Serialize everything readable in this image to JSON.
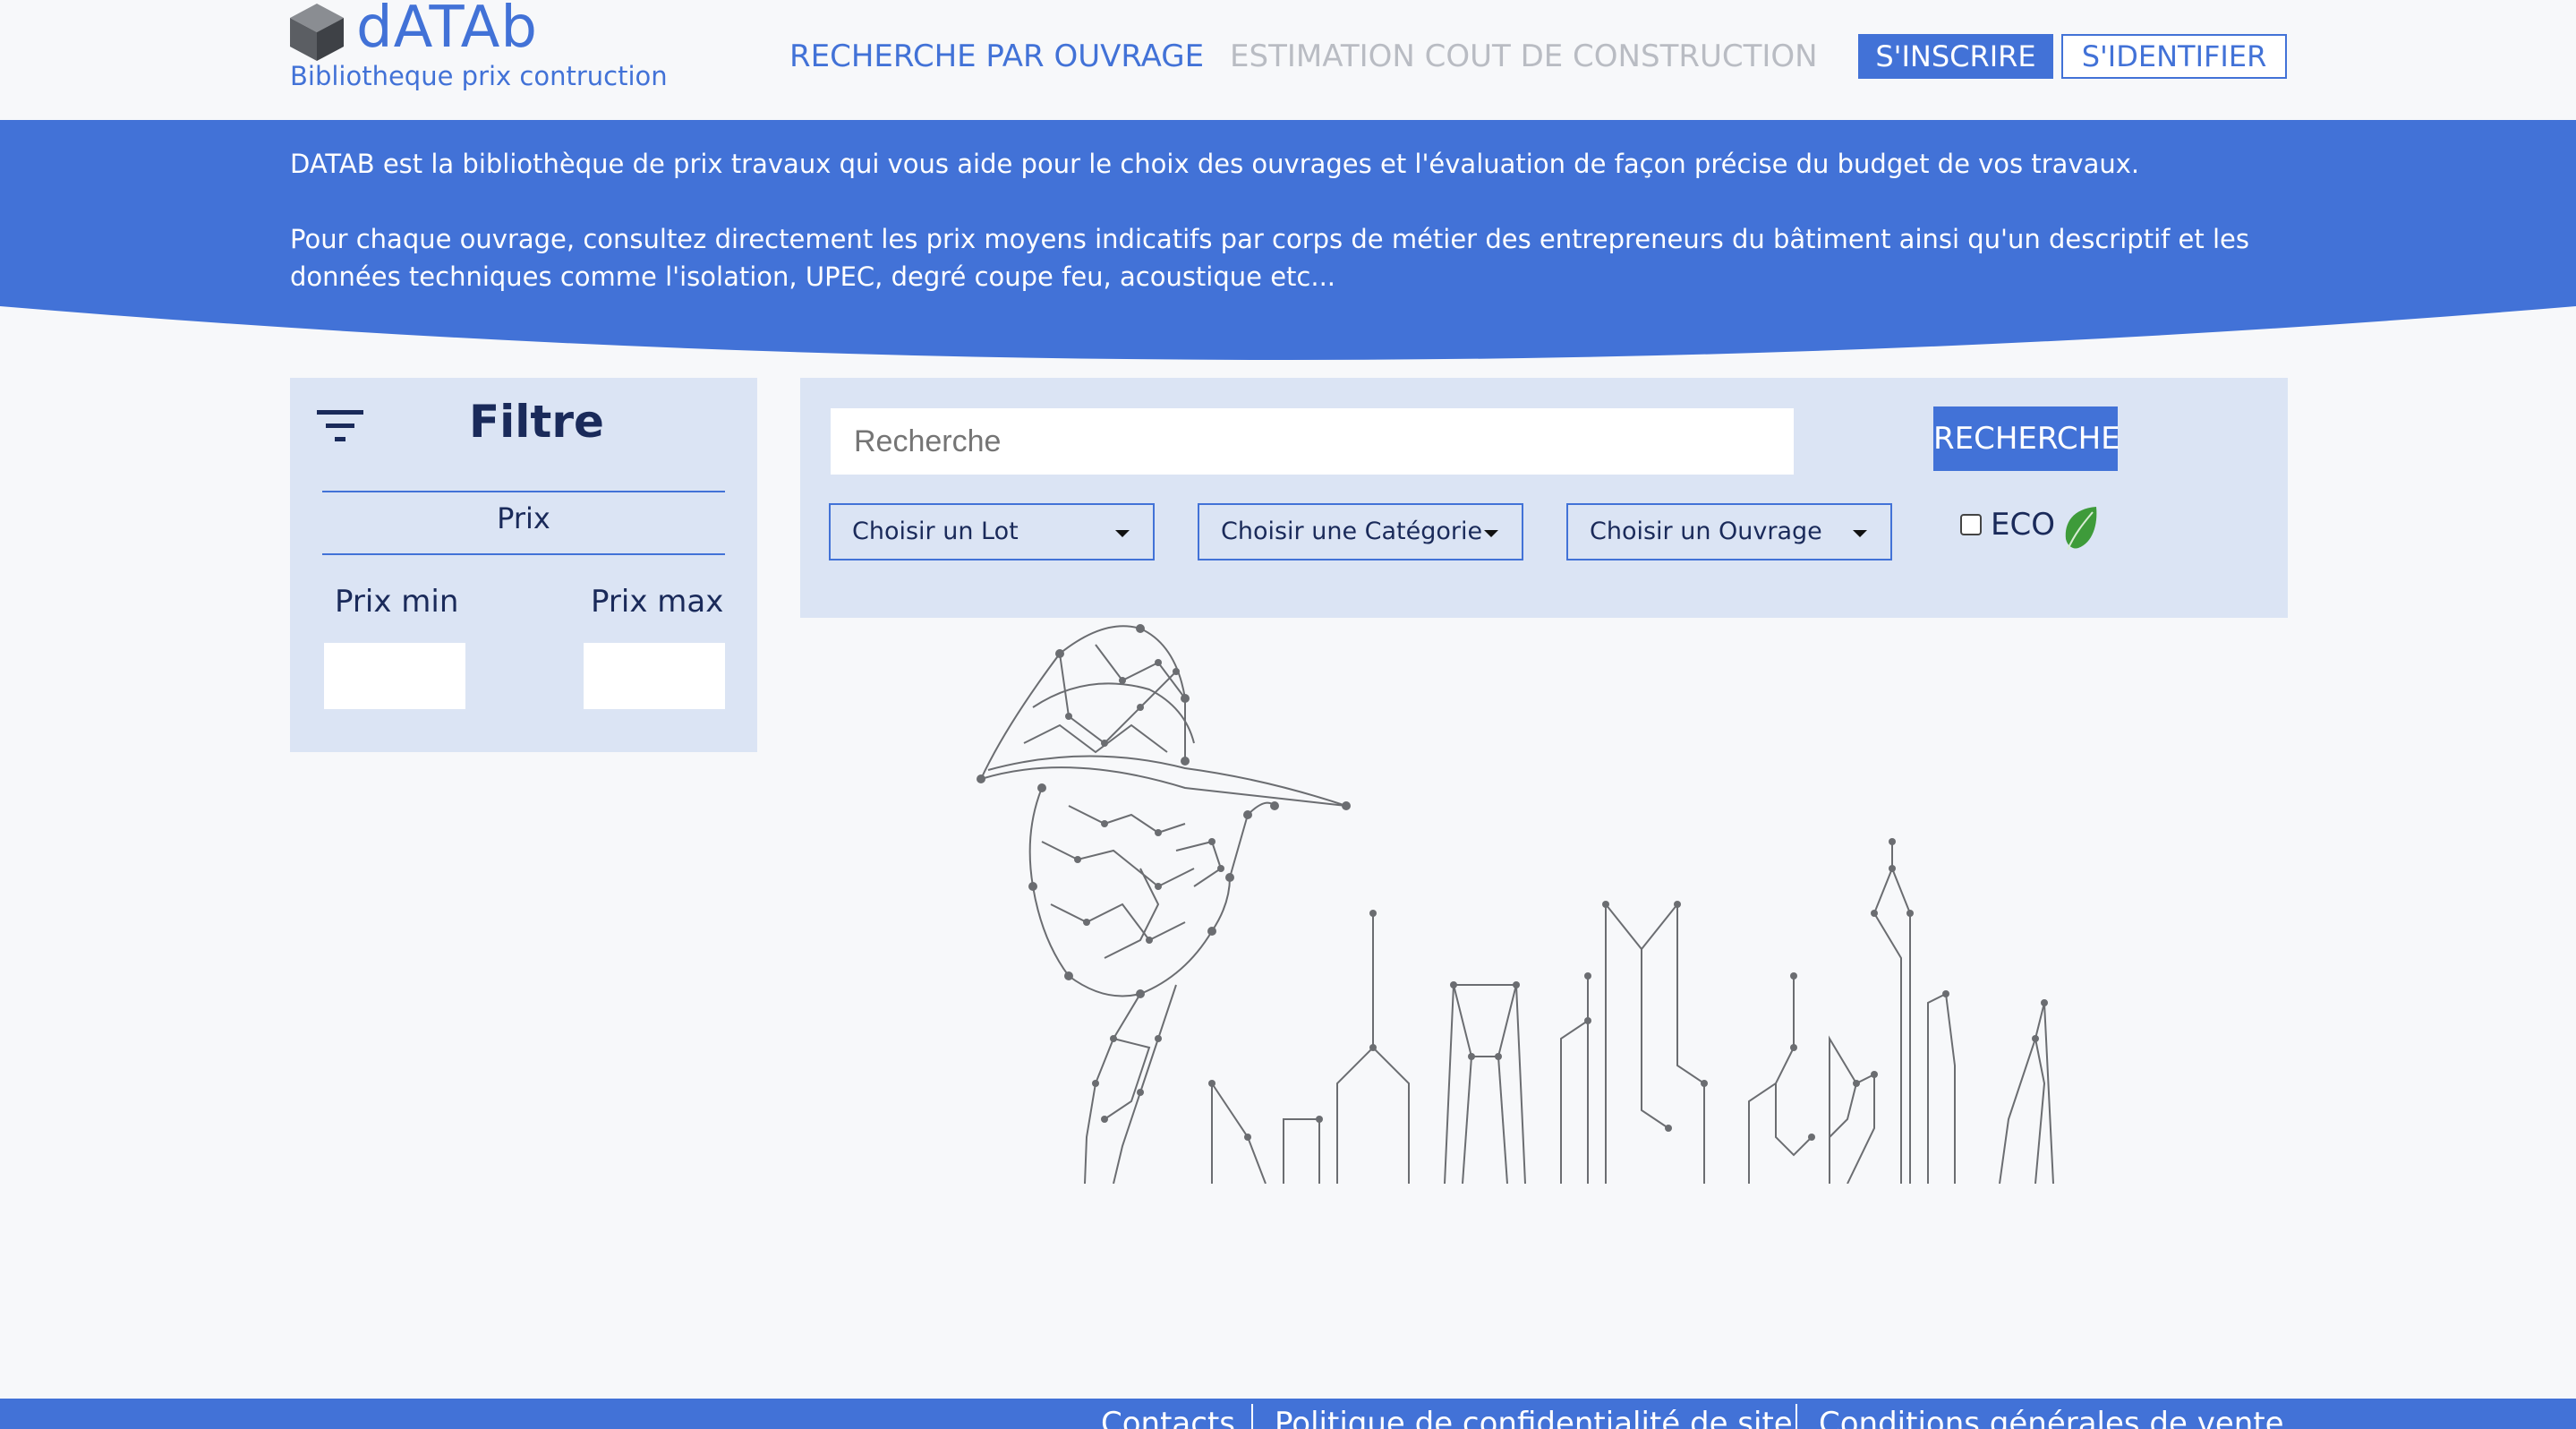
{
  "header": {
    "logo_name": "dATAb",
    "logo_tagline": "Bibliotheque prix contruction",
    "nav": [
      {
        "label": "RECHERCHE PAR OUVRAGE",
        "state": "active"
      },
      {
        "label": "ESTIMATION COUT DE CONSTRUCTION",
        "state": "inactive"
      }
    ],
    "signup_label": "S'INSCRIRE",
    "login_label": "S'IDENTIFIER"
  },
  "banner": {
    "paragraph1": "DATAB est la bibliothèque de prix travaux qui vous aide pour le choix des ouvrages et l'évaluation de façon précise du budget de vos travaux.",
    "paragraph2_line1": "Pour chaque ouvrage, consultez directement les prix moyens indicatifs par corps de métier des entrepreneurs du bâtiment ainsi qu'un descriptif et les",
    "paragraph2_line2": "données techniques comme l'isolation, UPEC, degré coupe feu, acoustique etc..."
  },
  "filter": {
    "title": "Filtre",
    "section": "Prix",
    "min_label": "Prix min",
    "max_label": "Prix max",
    "min_value": "",
    "max_value": ""
  },
  "search": {
    "placeholder": "Recherche",
    "button_label": "RECHERCHE",
    "dropdowns": [
      "Choisir un Lot",
      "Choisir une Catégorie",
      "Choisir un Ouvrage"
    ],
    "eco_label": "ECO",
    "eco_checked": false
  },
  "footer": {
    "links": [
      "Contacts",
      "Politique de confidentialité de site",
      "Conditions générales de vente"
    ]
  },
  "colors": {
    "primary": "#4272d7",
    "panel_bg": "#dbe4f4",
    "page_bg": "#f7f8fa",
    "inactive_nav": "#b9bcc3",
    "eco_leaf": "#3e9b3a"
  }
}
